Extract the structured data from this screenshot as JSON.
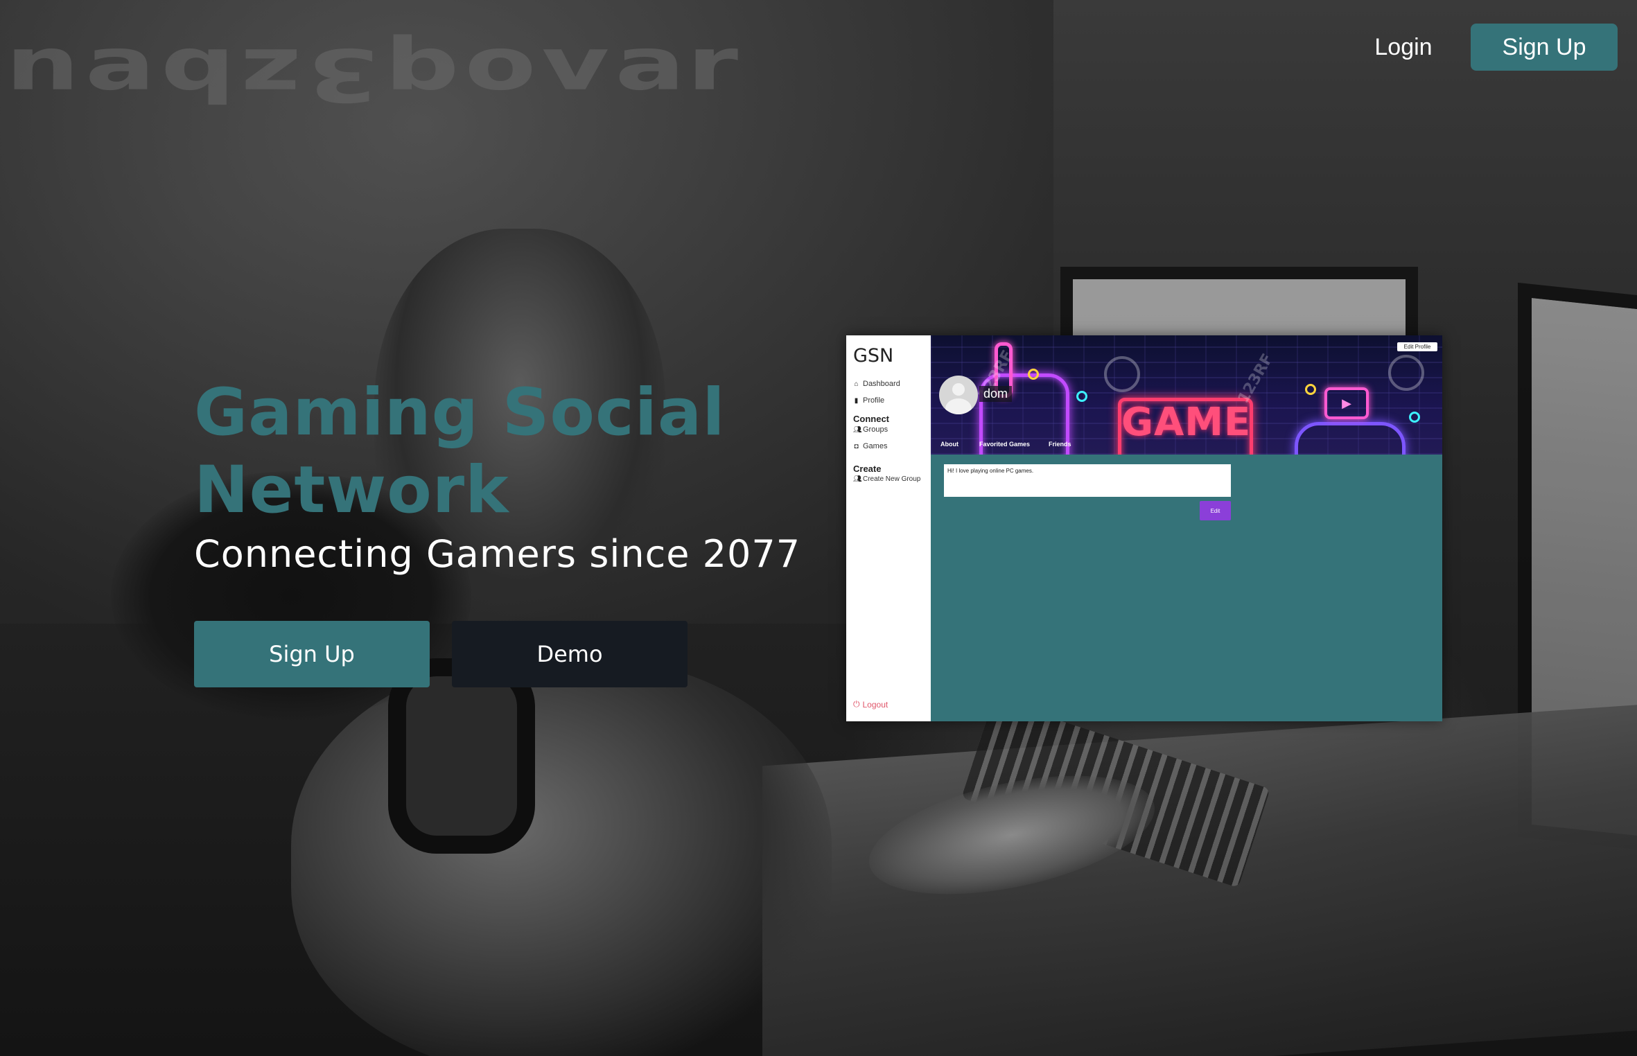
{
  "nav": {
    "login_label": "Login",
    "signup_label": "Sign Up"
  },
  "hero": {
    "title": "Gaming Social Network",
    "subtitle": "Connecting Gamers since 2077",
    "signup_label": "Sign Up",
    "demo_label": "Demo"
  },
  "preview": {
    "logo": "GSN",
    "nav_items": [
      {
        "label": "Dashboard",
        "icon": "home-icon"
      },
      {
        "label": "Profile",
        "icon": "id-badge-icon"
      }
    ],
    "connect": {
      "heading": "Connect",
      "items": [
        {
          "label": "Groups",
          "icon": "users-icon"
        },
        {
          "label": "Games",
          "icon": "gamepad-icon"
        }
      ]
    },
    "create": {
      "heading": "Create",
      "items": [
        {
          "label": "Create New Group",
          "icon": "users-icon"
        }
      ]
    },
    "logout_label": "Logout",
    "edit_profile_label": "Edit Profile",
    "username": "dom",
    "tabs": [
      "About",
      "Favorited Games",
      "Friends"
    ],
    "banner_text": "GAME",
    "watermark": "123RF",
    "bio": "Hi! I love playing online PC games.",
    "edit_label": "Edit"
  },
  "colors": {
    "accent": "#357379",
    "dark_button": "#161b22",
    "edit_button": "#8b3fd9",
    "logout": "#e0566a"
  }
}
